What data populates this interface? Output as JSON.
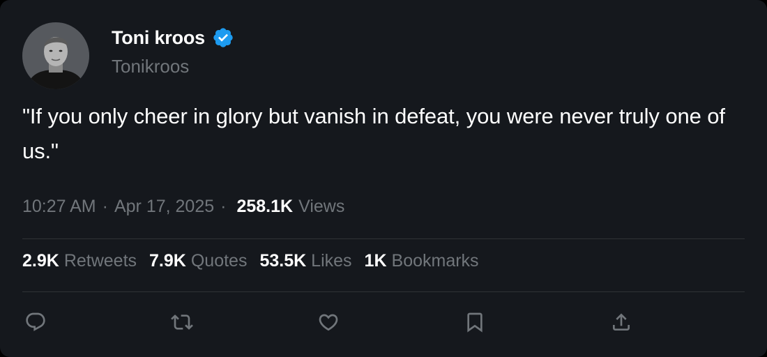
{
  "user": {
    "display_name": "Toni kroos",
    "handle": "Tonikroos",
    "verified": true,
    "avatar_icon": "profile-photo"
  },
  "tweet": {
    "text": "\"If you only cheer in glory but vanish in defeat, you were never truly one of us.\"",
    "time": "10:27 AM",
    "date": "Apr 17, 2025",
    "separator": "·",
    "views_count": "258.1K",
    "views_label": "Views"
  },
  "stats": [
    {
      "count": "2.9K",
      "label": "Retweets"
    },
    {
      "count": "7.9K",
      "label": "Quotes"
    },
    {
      "count": "53.5K",
      "label": "Likes"
    },
    {
      "count": "1K",
      "label": "Bookmarks"
    }
  ],
  "actions": [
    {
      "name": "reply",
      "icon": "reply-icon"
    },
    {
      "name": "retweet",
      "icon": "retweet-icon"
    },
    {
      "name": "like",
      "icon": "heart-icon"
    },
    {
      "name": "bookmark",
      "icon": "bookmark-icon"
    },
    {
      "name": "share",
      "icon": "share-icon"
    }
  ],
  "colors": {
    "background": "#15181d",
    "primary_text": "#ffffff",
    "secondary_text": "#71767b",
    "verified_badge": "#1d9bf0",
    "divider": "#2f3336"
  }
}
